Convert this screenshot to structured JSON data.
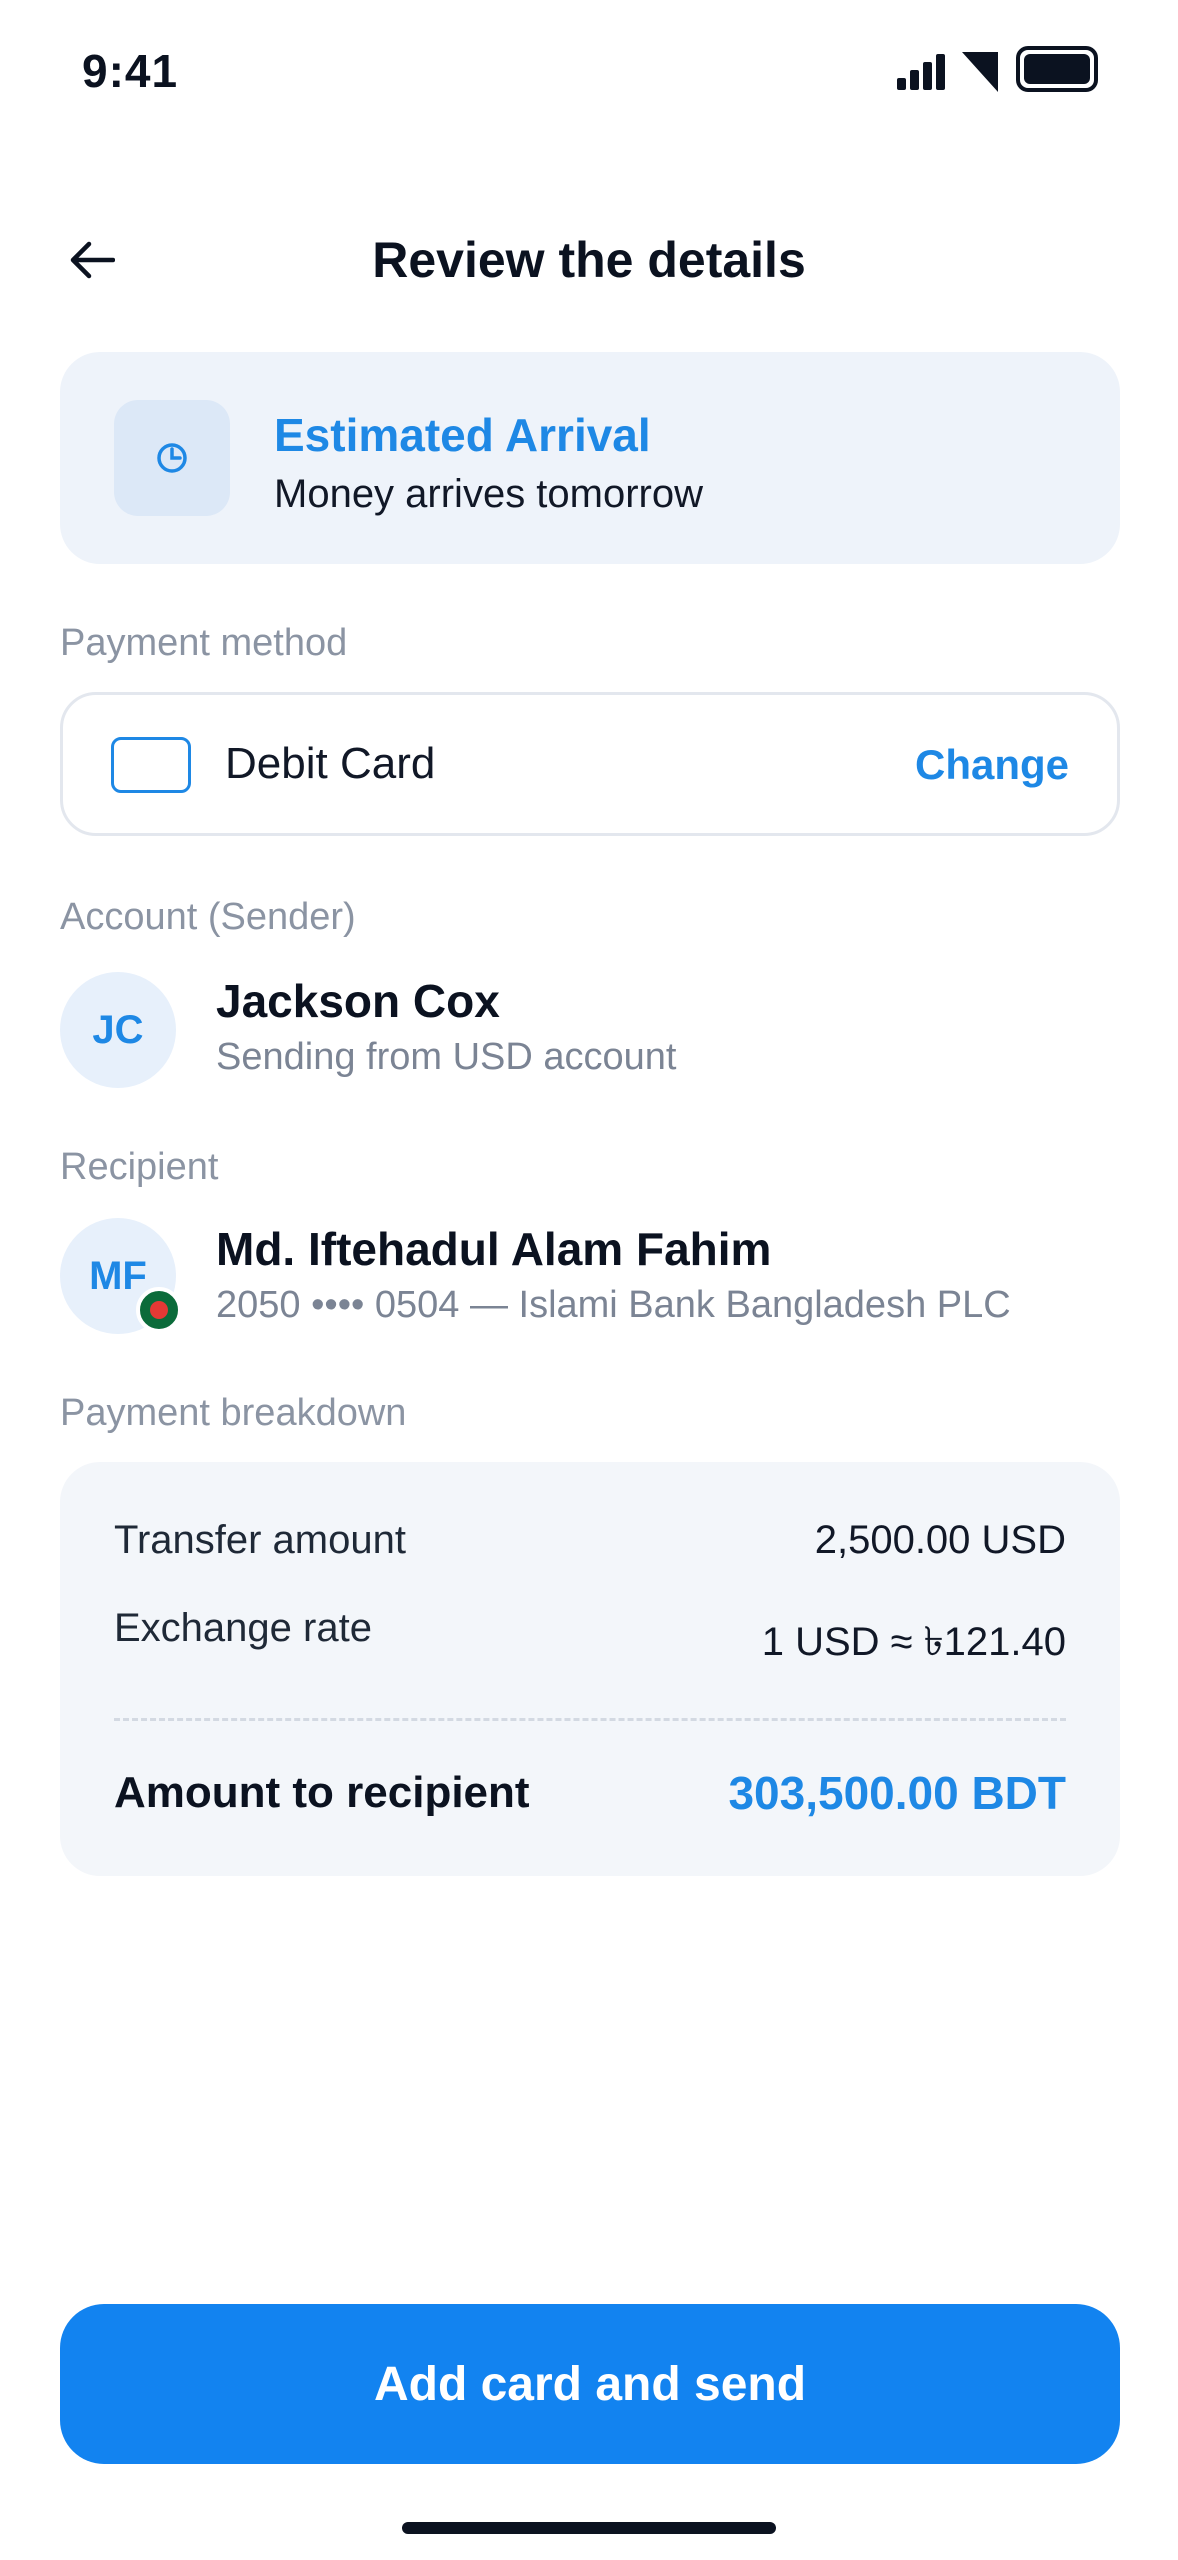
{
  "status_bar": {
    "time": "9:41"
  },
  "header": {
    "title": "Review the details",
    "back_icon": "arrow-left-icon"
  },
  "arrival": {
    "icon": "clock-icon",
    "title": "Estimated Arrival",
    "subtitle": "Money arrives tomorrow"
  },
  "payment_method": {
    "section_label": "Payment method",
    "icon": "card-icon",
    "label": "Debit Card",
    "change_label": "Change"
  },
  "sender": {
    "section_label": "Account (Sender)",
    "initials": "JC",
    "name": "Jackson Cox",
    "subtitle": "Sending from USD account"
  },
  "recipient": {
    "section_label": "Recipient",
    "initials": "MF",
    "name": "Md. Iftehadul Alam Fahim",
    "subtitle": "2050 •••• 0504 — Islami Bank Bangladesh PLC",
    "flag_icon": "bangladesh-flag-icon"
  },
  "breakdown": {
    "section_label": "Payment breakdown",
    "transfer_label": "Transfer amount",
    "transfer_value": "2,500.00 USD",
    "rate_label": "Exchange rate",
    "rate_value": "1 USD ≈ ৳121.40",
    "total_label": "Amount to recipient",
    "total_value": "303,500.00 BDT"
  },
  "primary_button": {
    "label": "Add card and send"
  },
  "colors": {
    "accent": "#1E88E5",
    "button": "#1283F0"
  }
}
